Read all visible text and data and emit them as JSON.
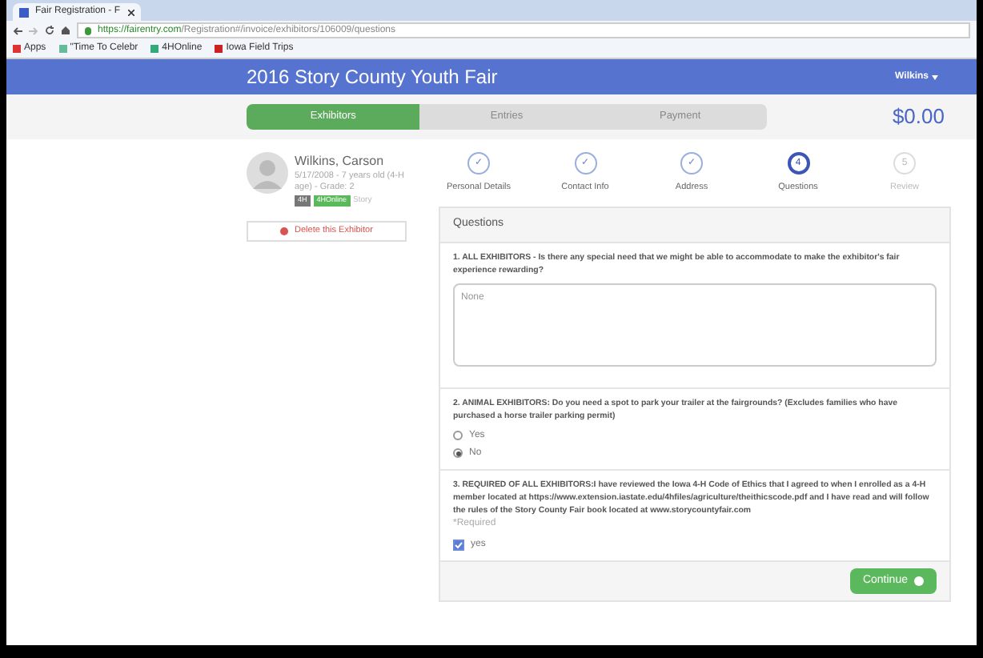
{
  "browser": {
    "tab_title": "Fair Registration - F",
    "url_host": "https://fairentry.com",
    "url_path": "/Registration#/invoice/exhibitors/106009/questions",
    "bookmarks": [
      "Apps",
      "\"Time To Celebr",
      "4HOnline",
      "Iowa Field Trips"
    ]
  },
  "header": {
    "title": "2016 Story County Youth Fair",
    "user": "Wilkins"
  },
  "progress": [
    {
      "label": "Exhibitors",
      "selected": true
    },
    {
      "label": "Entries",
      "selected": false
    },
    {
      "label": "Payment",
      "selected": false
    }
  ],
  "total": "$0.00",
  "exhibitor": {
    "name": "Wilkins, Carson",
    "details": "5/17/2008 - 7 years old (4-H age) - Grade: 2",
    "badges": [
      "4H",
      "4HOnline"
    ],
    "county": "Story",
    "delete_label": "Delete this Exhibitor"
  },
  "steps": [
    {
      "label": "Personal Details",
      "mark": "✓",
      "selected": false,
      "done": true
    },
    {
      "label": "Contact Info",
      "mark": "✓",
      "selected": false,
      "done": true
    },
    {
      "label": "Address",
      "mark": "✓",
      "selected": false,
      "done": true
    },
    {
      "label": "Questions",
      "mark": "4",
      "selected": true,
      "done": false
    },
    {
      "label": "Review",
      "mark": "5",
      "selected": false,
      "done": false
    }
  ],
  "panel_title": "Questions",
  "questions": [
    {
      "kind": "text",
      "text": "1. ALL EXHIBITORS - Is there any special need that we might be able to accommodate to make the exhibitor's fair experience rewarding?",
      "value": "None"
    },
    {
      "kind": "radio",
      "text": "2. ANIMAL EXHIBITORS: Do you need a spot to park your trailer at the fairgrounds? (Excludes families who have purchased a horse trailer parking permit)",
      "options": [
        {
          "label": "Yes",
          "selected": false
        },
        {
          "label": "No",
          "selected": true
        }
      ]
    },
    {
      "kind": "checkbox",
      "text": "3. REQUIRED OF ALL EXHIBITORS:I have reviewed the Iowa 4-H Code of Ethics that I agreed to when I enrolled as a 4-H member located at https://www.extension.iastate.edu/4hfiles/agriculture/theithicscode.pdf and I have read and will follow the rules of the Story County Fair book located at www.storycountyfair.com",
      "note": "*Required",
      "option": {
        "label": "yes",
        "checked": true
      }
    }
  ],
  "continue_label": "Continue"
}
